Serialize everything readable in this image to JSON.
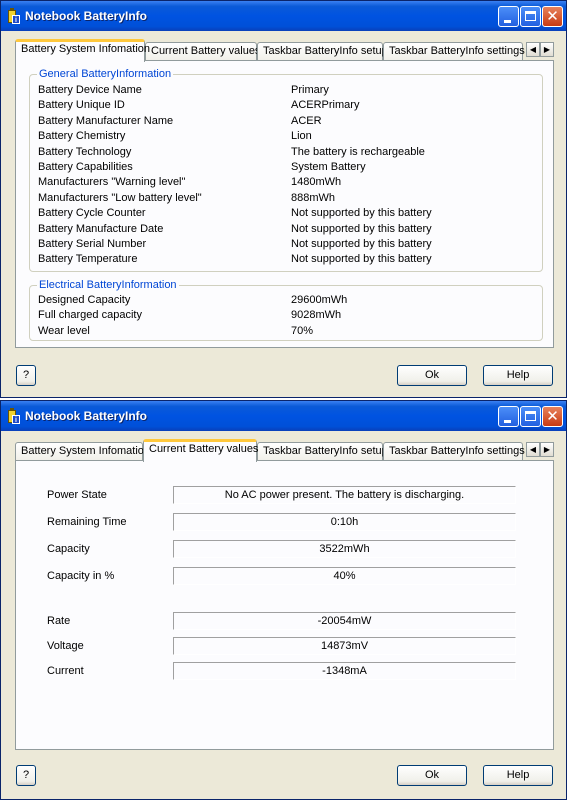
{
  "window1": {
    "title": "Notebook BatteryInfo",
    "tabs": [
      {
        "label": "Battery System Infomation"
      },
      {
        "label": "Current Battery values"
      },
      {
        "label": "Taskbar BatteryInfo setup"
      },
      {
        "label": "Taskbar BatteryInfo settings"
      }
    ],
    "general_group": {
      "title": "General BatteryInformation",
      "rows": [
        {
          "label": "Battery Device Name",
          "value": "Primary"
        },
        {
          "label": "Battery Unique ID",
          "value": "ACERPrimary"
        },
        {
          "label": "Battery Manufacturer Name",
          "value": "ACER"
        },
        {
          "label": "Battery Chemistry",
          "value": "Lion"
        },
        {
          "label": "Battery Technology",
          "value": "The battery is rechargeable"
        },
        {
          "label": "Battery Capabilities",
          "value": "System Battery"
        },
        {
          "label": "Manufacturers \"Warning level\"",
          "value": "1480mWh"
        },
        {
          "label": "Manufacturers \"Low battery level\"",
          "value": "888mWh"
        },
        {
          "label": "Battery Cycle Counter",
          "value": "Not supported by this battery"
        },
        {
          "label": "Battery Manufacture Date",
          "value": "Not supported by this battery"
        },
        {
          "label": "Battery Serial Number",
          "value": "Not supported by this battery"
        },
        {
          "label": "Battery Temperature",
          "value": "Not supported by this battery"
        }
      ]
    },
    "electrical_group": {
      "title": "Electrical BatteryInformation",
      "rows": [
        {
          "label": "Designed Capacity",
          "value": "29600mWh"
        },
        {
          "label": "Full charged capacity",
          "value": "9028mWh"
        },
        {
          "label": "Wear level",
          "value": "70%"
        }
      ]
    },
    "buttons": {
      "question": "?",
      "ok": "Ok",
      "help": "Help"
    }
  },
  "window2": {
    "title": "Notebook BatteryInfo",
    "tabs": [
      {
        "label": "Battery System Infomation"
      },
      {
        "label": "Current Battery values"
      },
      {
        "label": "Taskbar BatteryInfo setup"
      },
      {
        "label": "Taskbar BatteryInfo settings"
      }
    ],
    "fields": [
      {
        "label": "Power State",
        "value": "No AC power present. The battery is discharging."
      },
      {
        "label": "Remaining Time",
        "value": "0:10h"
      },
      {
        "label": "Capacity",
        "value": "3522mWh"
      },
      {
        "label": "Capacity in %",
        "value": "40%"
      },
      {
        "label": "Rate",
        "value": "-20054mW"
      },
      {
        "label": "Voltage",
        "value": "14873mV"
      },
      {
        "label": "Current",
        "value": "-1348mA"
      }
    ],
    "buttons": {
      "question": "?",
      "ok": "Ok",
      "help": "Help"
    }
  },
  "icons": {
    "app": "battery-info-icon",
    "minimize": "minimize-icon",
    "maximize": "maximize-icon",
    "close": "close-icon",
    "scroll_left": "chevron-left-icon",
    "scroll_right": "chevron-right-icon"
  },
  "colors": {
    "title_bar": "#0053e1",
    "active_tab_accent": "#ffc83c",
    "group_title": "#0046d5",
    "window_bg": "#ece9d8",
    "close_button": "#c83a12"
  }
}
